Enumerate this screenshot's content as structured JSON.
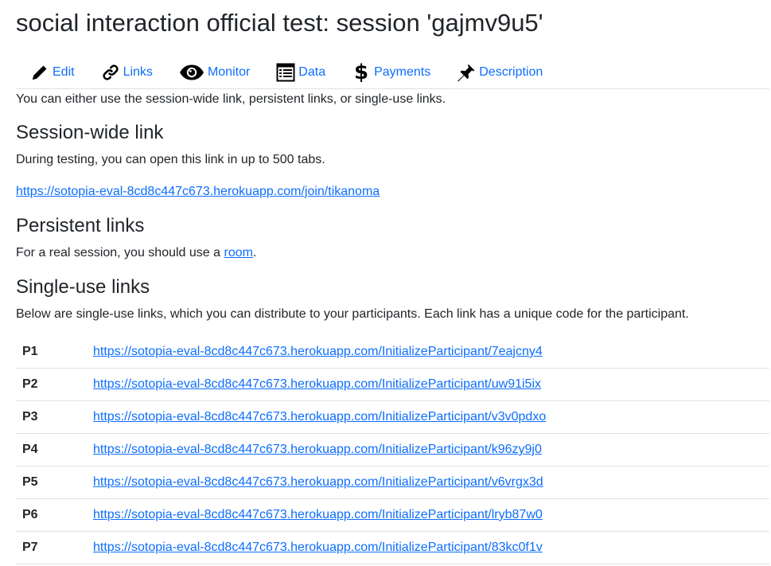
{
  "page": {
    "title": "social interaction official test: session 'gajmv9u5'"
  },
  "nav": {
    "tabs": [
      {
        "label": "Edit",
        "icon": "pencil-icon"
      },
      {
        "label": "Links",
        "icon": "link-icon"
      },
      {
        "label": "Monitor",
        "icon": "eye-icon"
      },
      {
        "label": "Data",
        "icon": "table-icon"
      },
      {
        "label": "Payments",
        "icon": "dollar-icon"
      },
      {
        "label": "Description",
        "icon": "pushpin-icon"
      }
    ]
  },
  "intro": "You can either use the session-wide link, persistent links, or single-use links.",
  "session_wide": {
    "heading": "Session-wide link",
    "text": "During testing, you can open this link in up to 500 tabs.",
    "url": "https://sotopia-eval-8cd8c447c673.herokuapp.com/join/tikanoma"
  },
  "persistent": {
    "heading": "Persistent links",
    "text_before": "For a real session, you should use a ",
    "link_text": "room",
    "text_after": "."
  },
  "single_use": {
    "heading": "Single-use links",
    "text": "Below are single-use links, which you can distribute to your participants. Each link has a unique code for the participant.",
    "rows": [
      {
        "code": "P1",
        "url": "https://sotopia-eval-8cd8c447c673.herokuapp.com/InitializeParticipant/7eajcny4"
      },
      {
        "code": "P2",
        "url": "https://sotopia-eval-8cd8c447c673.herokuapp.com/InitializeParticipant/uw91i5ix"
      },
      {
        "code": "P3",
        "url": "https://sotopia-eval-8cd8c447c673.herokuapp.com/InitializeParticipant/v3v0pdxo"
      },
      {
        "code": "P4",
        "url": "https://sotopia-eval-8cd8c447c673.herokuapp.com/InitializeParticipant/k96zy9j0"
      },
      {
        "code": "P5",
        "url": "https://sotopia-eval-8cd8c447c673.herokuapp.com/InitializeParticipant/v6vrgx3d"
      },
      {
        "code": "P6",
        "url": "https://sotopia-eval-8cd8c447c673.herokuapp.com/InitializeParticipant/lryb87w0"
      },
      {
        "code": "P7",
        "url": "https://sotopia-eval-8cd8c447c673.herokuapp.com/InitializeParticipant/83kc0f1v"
      }
    ]
  },
  "colors": {
    "link": "#0d6efd",
    "text": "#212529",
    "border": "#dee2e6"
  }
}
